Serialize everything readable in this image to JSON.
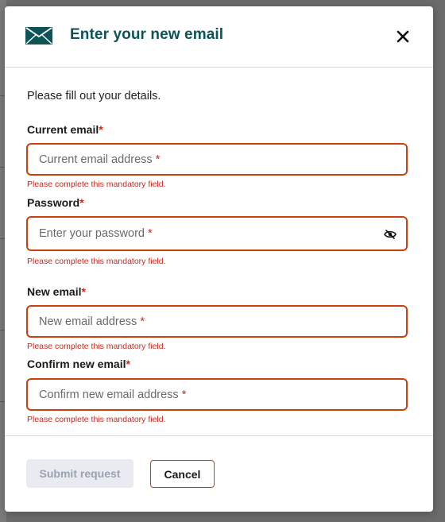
{
  "dialog": {
    "title": "Enter your new email",
    "intro": "Please fill out your details.",
    "required_marker": "*"
  },
  "fields": [
    {
      "label": "Current email",
      "placeholder": "Current email address",
      "error": "Please complete this mandatory field."
    },
    {
      "label": "Password",
      "placeholder": "Enter your password",
      "error": "Please complete this mandatory field."
    },
    {
      "label": "New email",
      "placeholder": "New email address",
      "error": "Please complete this mandatory field."
    },
    {
      "label": "Confirm new email",
      "placeholder": "Confirm new email address",
      "error": "Please complete this mandatory field."
    }
  ],
  "buttons": {
    "submit_label": "Submit request",
    "cancel_label": "Cancel"
  },
  "colors": {
    "title": "#0d5357",
    "error": "#c8281e",
    "input_border_error": "#c9400f",
    "submit_disabled_bg": "#e9ebf0"
  },
  "icons": {
    "header": "envelope-icon",
    "close": "close-icon",
    "password_toggle": "eye-slash-icon"
  }
}
